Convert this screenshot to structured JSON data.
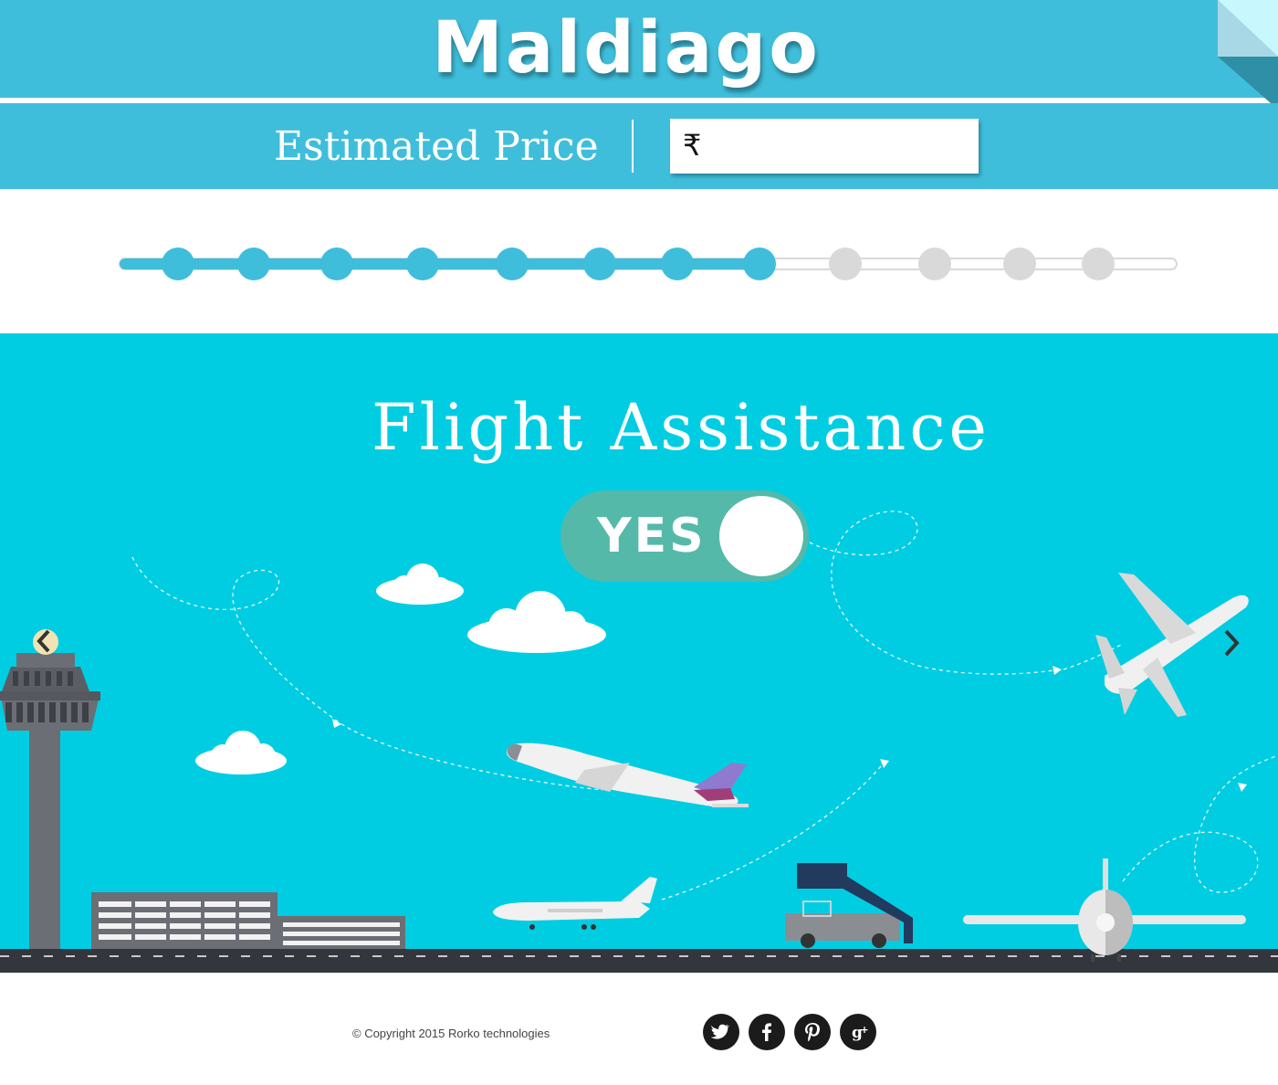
{
  "brand": {
    "title": "Maldiago"
  },
  "price": {
    "label": "Estimated Price",
    "currency_icon": "rupee-icon",
    "currency_symbol": "₹",
    "value": ""
  },
  "progress": {
    "total_steps": 12,
    "completed_steps": 8,
    "active_color": "#3fbedb",
    "inactive_color": "#d9d9d9"
  },
  "hero": {
    "title": "Flight Assistance",
    "toggle": {
      "label": "YES",
      "state": "on"
    },
    "background_color": "#00cde2",
    "nav": {
      "prev_icon": "chevron-left-icon",
      "next_icon": "chevron-right-icon"
    }
  },
  "footer": {
    "copyright": "© Copyright 2015 Rorko technologies",
    "social": [
      {
        "name": "twitter",
        "icon": "twitter-icon",
        "glyph": ""
      },
      {
        "name": "facebook",
        "icon": "facebook-icon",
        "glyph": "f"
      },
      {
        "name": "pinterest",
        "icon": "pinterest-icon",
        "glyph": "P"
      },
      {
        "name": "google-plus",
        "icon": "google-plus-icon",
        "glyph": "g+"
      }
    ]
  }
}
